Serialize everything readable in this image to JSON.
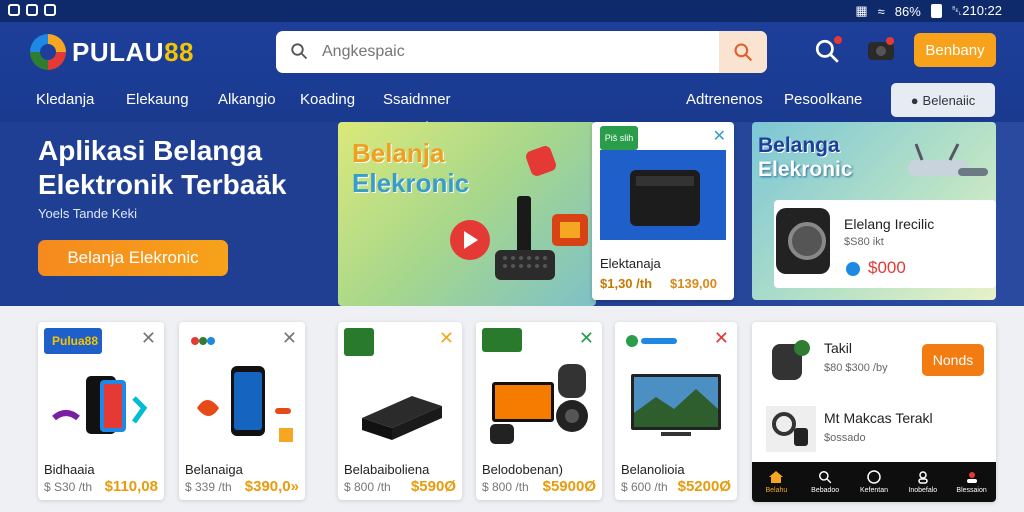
{
  "status": {
    "clock": "␇210:22",
    "signal": "86%"
  },
  "brand": {
    "name_main": "PULAU",
    "name_num": "88"
  },
  "search": {
    "placeholder": "Angkespaic"
  },
  "header": {
    "cta_label": "Benbany"
  },
  "nav": {
    "items": [
      "Kledanja",
      "Elekaung",
      "Alkangio",
      "Koading",
      "Ssaidnner"
    ],
    "right_items": [
      "Adtrenenos",
      "Pesoolkane"
    ],
    "account_label": "Belenaiic"
  },
  "hero": {
    "title": "Aplikasi Belanga Elektronik Terbaäk",
    "subtitle": "Yoels Tande Keki",
    "cta_label": "Belanja  Elekronic"
  },
  "banner_left": {
    "line1": "Belanja",
    "line2": "Elekronic"
  },
  "featured_card": {
    "tag": "Piš slih",
    "name": "Elektanaja",
    "old_price": "$1,30 /th",
    "price": "$139,00"
  },
  "banner_right": {
    "line1": "Belanga",
    "line2": "Elekronic",
    "card_title": "Elelang Irecilic",
    "card_sub": "$S80 ikt",
    "card_price": "$000"
  },
  "products": [
    {
      "badge": "Pulua88",
      "name": "Bidhaaia",
      "old": "$ S30 /th",
      "price": "$110,08"
    },
    {
      "badge": "",
      "name": "Belanaiga",
      "old": "$ 339 /th",
      "price": "$390,0»"
    },
    {
      "badge": "",
      "name": "Belabaiboliena",
      "old": "$ 800 /th",
      "price": "$590Ø"
    },
    {
      "badge": "",
      "name": "Belodobenan)",
      "old": "$ 800 /th",
      "price": "$5900Ø"
    },
    {
      "badge": "",
      "name": "Belanolioia",
      "old": "$ 600 /th",
      "price": "$5200Ø"
    }
  ],
  "side_panel": {
    "item1_title": "Takil",
    "item1_sub": "$80 $300 /by",
    "item1_btn": "Nonds",
    "item2_title": "Mt Makcas Terakl",
    "item2_sub": "$ossado"
  },
  "tabbar": [
    "Belahu",
    "Bebadoo",
    "Kefentan",
    "Inobefalo",
    "Blessaion"
  ],
  "colors": {
    "primary": "#1d3f9a",
    "accent": "#f7a21a",
    "price": "#e89b0c"
  }
}
